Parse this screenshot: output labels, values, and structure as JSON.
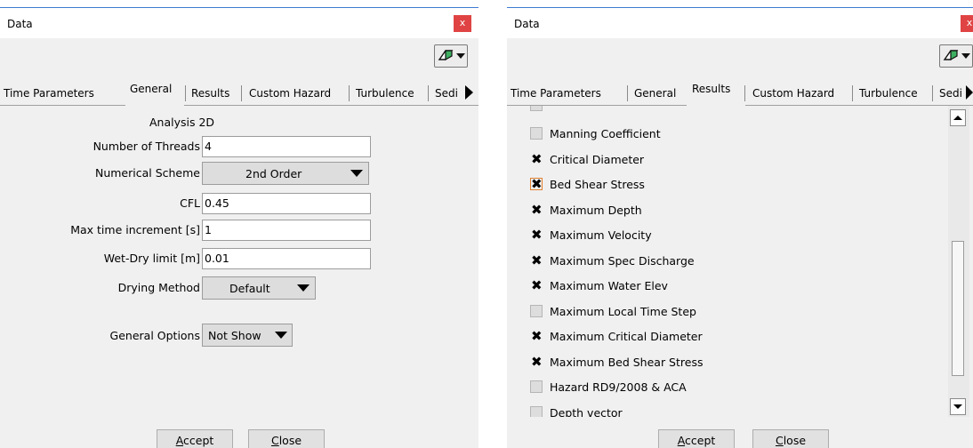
{
  "left_window": {
    "title": "Data",
    "close_glyph": "x",
    "tabs": [
      "Time Parameters",
      "General",
      "Results",
      "Custom Hazard",
      "Turbulence",
      "Sedi"
    ],
    "active_tab": "General",
    "analysis_label": "Analysis 2D",
    "fields": {
      "threads": {
        "label": "Number of Threads",
        "value": "4"
      },
      "scheme": {
        "label": "Numerical Scheme",
        "value": "2nd Order"
      },
      "cfl": {
        "label": "CFL",
        "value": "0.45"
      },
      "max_time": {
        "label": "Max time increment [s]",
        "value": "1"
      },
      "wetdry": {
        "label": "Wet-Dry limit [m]",
        "value": "0.01"
      },
      "drying": {
        "label": "Drying Method",
        "value": "Default"
      },
      "general_options": {
        "label": "General Options",
        "value": "Not Show"
      }
    },
    "buttons": {
      "accept": "ccept",
      "accept_mnemonic": "A",
      "close": "lose",
      "close_mnemonic": "C"
    }
  },
  "right_window": {
    "title": "Data",
    "close_glyph": "x",
    "tabs": [
      "Time Parameters",
      "General",
      "Results",
      "Custom Hazard",
      "Turbulence",
      "Sedi"
    ],
    "active_tab": "Results",
    "results_items": [
      {
        "label": "Manning Coefficient",
        "checked": false
      },
      {
        "label": "Critical Diameter",
        "checked": true
      },
      {
        "label": "Bed Shear Stress",
        "checked": true,
        "focused": true
      },
      {
        "label": "Maximum Depth",
        "checked": true
      },
      {
        "label": "Maximum Velocity",
        "checked": true
      },
      {
        "label": "Maximum Spec Discharge",
        "checked": true
      },
      {
        "label": "Maximum Water Elev",
        "checked": true
      },
      {
        "label": "Maximum Local Time Step",
        "checked": false
      },
      {
        "label": "Maximum Critical Diameter",
        "checked": true
      },
      {
        "label": "Maximum Bed Shear Stress",
        "checked": true
      },
      {
        "label": "Hazard RD9/2008 & ACA",
        "checked": false
      },
      {
        "label": "Depth vector",
        "checked": false
      }
    ],
    "buttons": {
      "accept": "ccept",
      "accept_mnemonic": "A",
      "close": "lose",
      "close_mnemonic": "C"
    }
  },
  "colors": {
    "close_red": "#e04343",
    "title_accent": "#3c7bd3",
    "focus_orange": "#e08030"
  },
  "icons": [
    "close-icon",
    "eraser-icon",
    "dropdown-arrow-icon",
    "tab-scroll-right-icon",
    "scroll-up-icon",
    "scroll-down-icon",
    "check-x-icon"
  ]
}
